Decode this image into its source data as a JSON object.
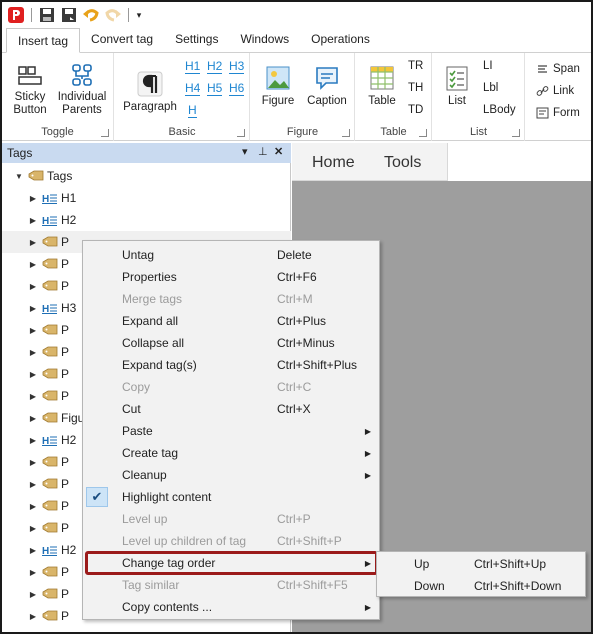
{
  "tabs": [
    {
      "label": "Insert tag",
      "active": true
    },
    {
      "label": "Convert tag",
      "active": false
    },
    {
      "label": "Settings",
      "active": false
    },
    {
      "label": "Windows",
      "active": false
    },
    {
      "label": "Operations",
      "active": false
    }
  ],
  "ribbon": {
    "toggle": {
      "label": "Toggle",
      "sticky": "Sticky Button",
      "sticky_l1": "Sticky",
      "sticky_l2": "Button",
      "ip_l1": "Individual",
      "ip_l2": "Parents"
    },
    "basic": {
      "label": "Basic",
      "paragraph": "Paragraph",
      "h1": "H1",
      "h2": "H2",
      "h3": "H3",
      "h4": "H4",
      "h5": "H5",
      "h6": "H6",
      "h": "H"
    },
    "figure": {
      "label": "Figure",
      "figure": "Figure",
      "caption": "Caption"
    },
    "table": {
      "label": "Table",
      "table": "Table",
      "tr": "TR",
      "th": "TH",
      "td": "TD"
    },
    "list": {
      "label": "List",
      "list": "List",
      "li": "LI",
      "lbl": "Lbl",
      "lbody": "LBody"
    },
    "other": {
      "span": "Span",
      "link": "Link",
      "form": "Form"
    }
  },
  "panel": {
    "title": "Tags",
    "pin": "▾  ‡  ✕"
  },
  "tree": [
    {
      "label": "Tags",
      "type": "root",
      "expanded": true
    },
    {
      "label": "H1",
      "type": "heading"
    },
    {
      "label": "H2",
      "type": "heading"
    },
    {
      "label": "P",
      "type": "tag",
      "selected": true
    },
    {
      "label": "P",
      "type": "tag"
    },
    {
      "label": "P",
      "type": "tag"
    },
    {
      "label": "H3",
      "type": "heading"
    },
    {
      "label": "P",
      "type": "tag"
    },
    {
      "label": "P",
      "type": "tag"
    },
    {
      "label": "P",
      "type": "tag"
    },
    {
      "label": "P",
      "type": "tag"
    },
    {
      "label": "Figu",
      "type": "tag"
    },
    {
      "label": "H2",
      "type": "heading"
    },
    {
      "label": "P",
      "type": "tag"
    },
    {
      "label": "P",
      "type": "tag"
    },
    {
      "label": "P",
      "type": "tag"
    },
    {
      "label": "P",
      "type": "tag"
    },
    {
      "label": "H2",
      "type": "heading"
    },
    {
      "label": "P",
      "type": "tag"
    },
    {
      "label": "P",
      "type": "tag"
    },
    {
      "label": "P",
      "type": "tag"
    },
    {
      "label": "P",
      "type": "tag"
    }
  ],
  "nav": {
    "home": "Home",
    "tools": "Tools"
  },
  "menu": [
    {
      "label": "Untag",
      "shortcut": "Delete",
      "disabled": false,
      "submenu": false
    },
    {
      "label": "Properties",
      "shortcut": "Ctrl+F6",
      "disabled": false,
      "submenu": false
    },
    {
      "label": "Merge tags",
      "shortcut": "Ctrl+M",
      "disabled": true,
      "submenu": false
    },
    {
      "label": "Expand all",
      "shortcut": "Ctrl+Plus",
      "disabled": false,
      "submenu": false
    },
    {
      "label": "Collapse all",
      "shortcut": "Ctrl+Minus",
      "disabled": false,
      "submenu": false
    },
    {
      "label": "Expand tag(s)",
      "shortcut": "Ctrl+Shift+Plus",
      "disabled": false,
      "submenu": false
    },
    {
      "label": "Copy",
      "shortcut": "Ctrl+C",
      "disabled": true,
      "submenu": false
    },
    {
      "label": "Cut",
      "shortcut": "Ctrl+X",
      "disabled": false,
      "submenu": false
    },
    {
      "label": "Paste",
      "shortcut": "",
      "disabled": false,
      "submenu": true
    },
    {
      "label": "Create tag",
      "shortcut": "",
      "disabled": false,
      "submenu": true
    },
    {
      "label": "Cleanup",
      "shortcut": "",
      "disabled": false,
      "submenu": true
    },
    {
      "label": "Highlight content",
      "shortcut": "",
      "disabled": false,
      "submenu": false,
      "checked": true
    },
    {
      "label": "Level up",
      "shortcut": "Ctrl+P",
      "disabled": true,
      "submenu": false
    },
    {
      "label": "Level up children of tag",
      "shortcut": "Ctrl+Shift+P",
      "disabled": true,
      "submenu": false
    },
    {
      "label": "Change tag order",
      "shortcut": "",
      "disabled": false,
      "submenu": true,
      "highlighted": true
    },
    {
      "label": "Tag similar",
      "shortcut": "Ctrl+Shift+F5",
      "disabled": true,
      "submenu": false
    },
    {
      "label": "Copy contents ...",
      "shortcut": "",
      "disabled": false,
      "submenu": true
    }
  ],
  "submenu": [
    {
      "label": "Up",
      "shortcut": "Ctrl+Shift+Up"
    },
    {
      "label": "Down",
      "shortcut": "Ctrl+Shift+Down"
    }
  ],
  "colors": {
    "accent": "#1f86d1",
    "highlight_border": "#9b1b1b",
    "panel_header": "#c9daf0",
    "tag_icon": "#d9b56a"
  }
}
